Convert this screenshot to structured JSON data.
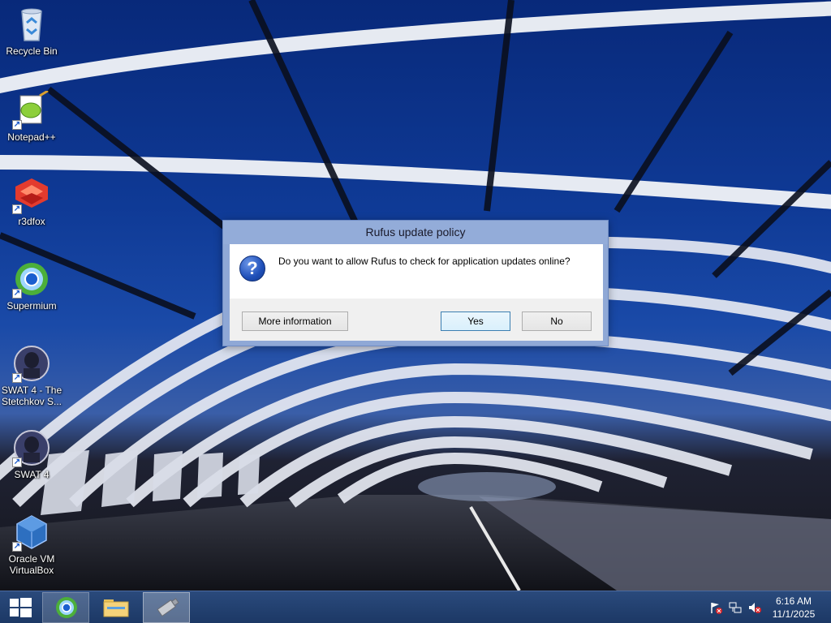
{
  "desktop": {
    "icons": [
      {
        "label": "Recycle Bin",
        "icon": "recycle-bin-icon"
      },
      {
        "label": "Notepad++",
        "icon": "notepadpp-icon"
      },
      {
        "label": "r3dfox",
        "icon": "r3dfox-icon"
      },
      {
        "label": "Supermium",
        "icon": "supermium-icon"
      },
      {
        "label": "SWAT 4 - The Stetchkov S...",
        "icon": "swat4-tss-icon"
      },
      {
        "label": "SWAT 4",
        "icon": "swat4-icon"
      },
      {
        "label": "Oracle VM VirtualBox",
        "icon": "virtualbox-icon"
      }
    ]
  },
  "dialog": {
    "title": "Rufus update policy",
    "icon": "question-icon",
    "message": "Do you want to allow Rufus to check for application updates online?",
    "buttons": {
      "more_info": "More information",
      "yes": "Yes",
      "no": "No"
    }
  },
  "taskbar": {
    "apps": [
      {
        "name": "Supermium",
        "icon": "supermium-icon"
      },
      {
        "name": "File Explorer",
        "icon": "folder-icon"
      },
      {
        "name": "Rufus",
        "icon": "usb-drive-icon"
      }
    ],
    "tray": [
      "action-center-flag-icon",
      "network-icon",
      "volume-muted-icon"
    ],
    "clock": {
      "time": "6:16 AM",
      "date": "11/1/2025"
    }
  },
  "colors": {
    "taskbar": "#1c3865",
    "dialog_frame": "#93acd9",
    "default_button_border": "#3c7fb1"
  }
}
